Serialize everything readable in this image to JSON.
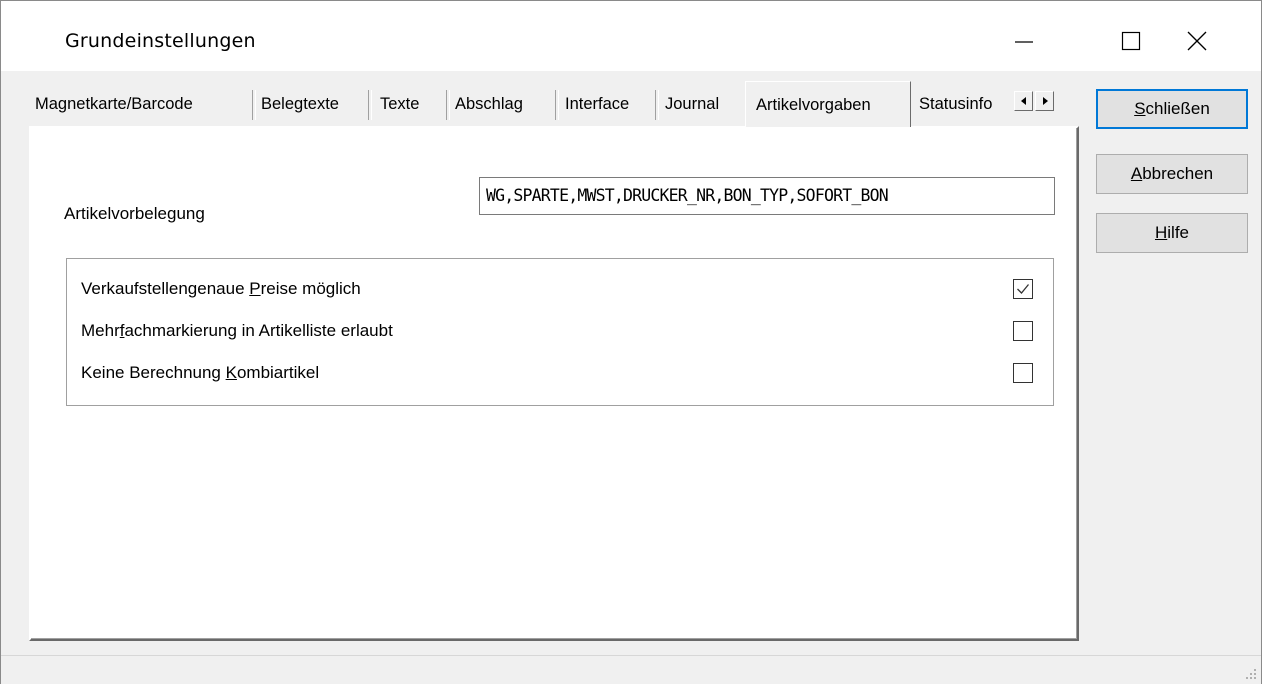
{
  "window": {
    "title": "Grundeinstellungen"
  },
  "tabs": [
    {
      "label": "Magnetkarte/Barcode",
      "active": false
    },
    {
      "label": "Belegtexte",
      "active": false
    },
    {
      "label": "Texte",
      "active": false
    },
    {
      "label": "Abschlag",
      "active": false
    },
    {
      "label": "Interface",
      "active": false
    },
    {
      "label": "Journal",
      "active": false
    },
    {
      "label": "Artikelvorgaben",
      "active": true
    },
    {
      "label": "Statusinfo",
      "active": false
    }
  ],
  "artikel": {
    "label": "Artikelvorbelegung",
    "value": "WG,SPARTE,MWST,DRUCKER_NR,BON_TYP,SOFORT_BON"
  },
  "options": [
    {
      "pre": "Verkaufstellengenaue ",
      "acc": "P",
      "post": "reise möglich",
      "checked": true
    },
    {
      "pre": "Mehr",
      "acc": "f",
      "post": "achmarkierung in Artikelliste erlaubt",
      "checked": false
    },
    {
      "pre": "Keine Berechnung ",
      "acc": "K",
      "post": "ombiartikel",
      "checked": false
    }
  ],
  "buttons": {
    "close": {
      "acc": "S",
      "rest": "chließen"
    },
    "cancel": {
      "acc": "A",
      "rest": "bbrechen"
    },
    "help": {
      "acc": "H",
      "rest": "ilfe"
    }
  },
  "icons": {
    "minimize": "minimize-icon",
    "maximize": "maximize-icon",
    "close": "close-icon",
    "tab_left": "arrow-left-icon",
    "tab_right": "arrow-right-icon",
    "check": "checkmark-icon",
    "grip": "resize-grip-icon"
  }
}
